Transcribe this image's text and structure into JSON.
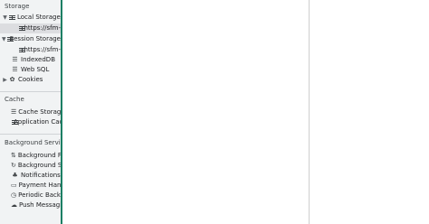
{
  "sidebar": {
    "storage": {
      "title": "Storage",
      "local_storage": {
        "label": "Local Storage",
        "child": "https://sfm-"
      },
      "session_storage": {
        "label": "Session Storage",
        "child": "https://sfm-"
      },
      "indexeddb": "IndexedDB",
      "websql": "Web SQL",
      "cookies": "Cookies"
    },
    "cache": {
      "title": "Cache",
      "cache_storage": "Cache Storage",
      "application_cache": "Application Cache"
    },
    "background_services": {
      "title": "Background Services",
      "items": [
        {
          "label": "Background Fetch",
          "icon": "arrows-updown-icon"
        },
        {
          "label": "Background Sync",
          "icon": "sync-icon"
        },
        {
          "label": "Notifications",
          "icon": "bell-icon"
        },
        {
          "label": "Payment Handler",
          "icon": "card-icon"
        },
        {
          "label": "Periodic Background Sync",
          "icon": "clock-icon"
        },
        {
          "label": "Push Messaging",
          "icon": "cloud-icon"
        }
      ]
    }
  },
  "colors": {
    "sidebar_bg": "#f1f3f4",
    "selected_row": "#dcdde0",
    "splitter": "#1a7f64"
  }
}
